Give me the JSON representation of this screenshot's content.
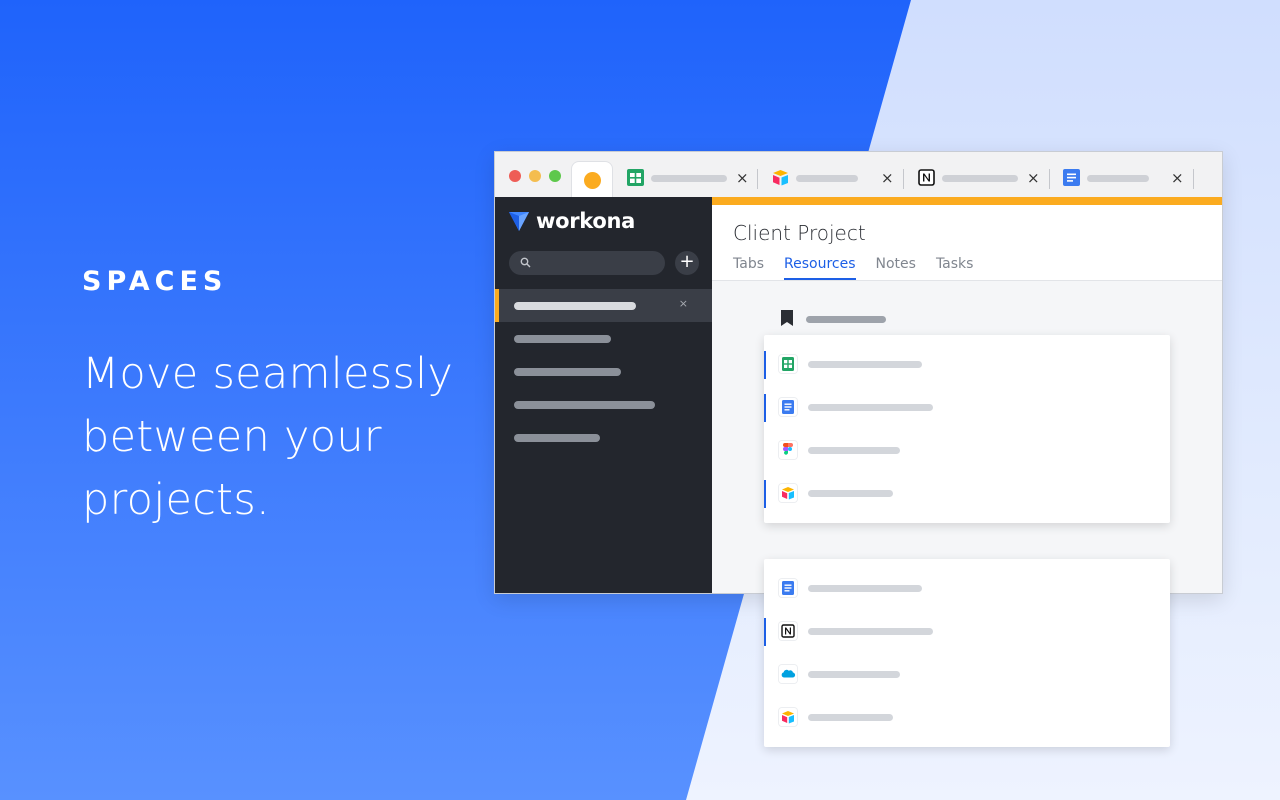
{
  "hero": {
    "eyebrow": "SPACES",
    "headline": "Move seamlessly between your projects."
  },
  "brand": {
    "name": "workona",
    "accent": "#fbab1f",
    "primary": "#1d5fe6"
  },
  "browser_tabs": [
    {
      "icon": "google-sheets-icon",
      "close": "×"
    },
    {
      "icon": "airtable-icon",
      "close": "×"
    },
    {
      "icon": "notion-icon",
      "close": "×"
    },
    {
      "icon": "google-docs-icon",
      "close": "×"
    }
  ],
  "sidebar": {
    "add_label": "+",
    "active_close": "×"
  },
  "main": {
    "title": "Client Project",
    "tabs": [
      "Tabs",
      "Resources",
      "Notes",
      "Tasks"
    ],
    "active_tab": "Resources"
  },
  "resource_groups": [
    {
      "items": [
        {
          "icon": "google-sheets-icon"
        },
        {
          "icon": "google-docs-icon"
        },
        {
          "icon": "figma-icon"
        },
        {
          "icon": "airtable-icon"
        }
      ]
    },
    {
      "items": [
        {
          "icon": "google-docs-icon"
        },
        {
          "icon": "notion-icon"
        },
        {
          "icon": "salesforce-icon"
        },
        {
          "icon": "airtable-icon"
        }
      ]
    }
  ]
}
